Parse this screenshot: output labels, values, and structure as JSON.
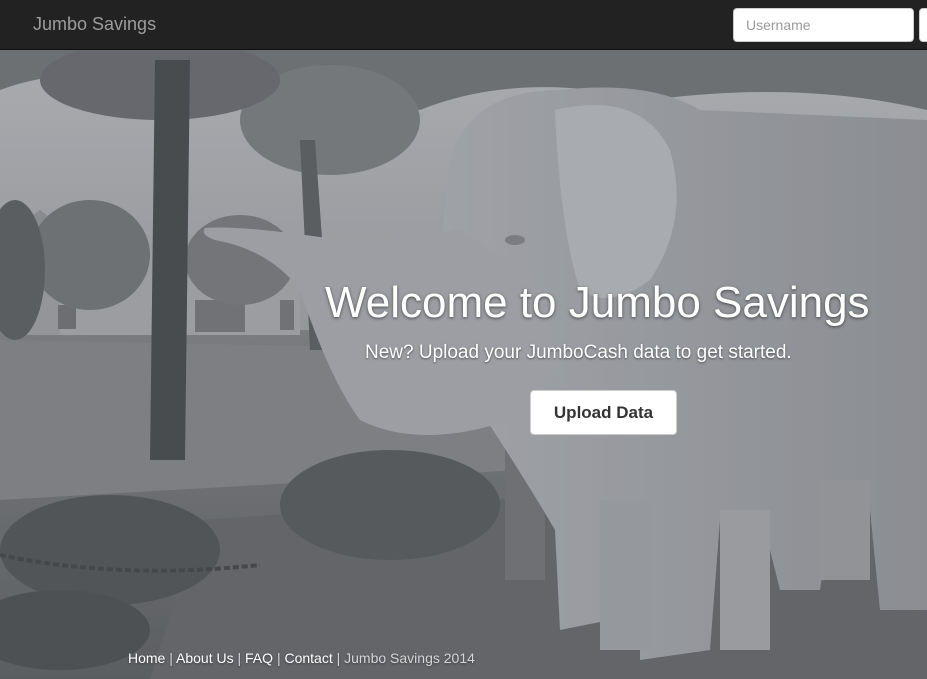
{
  "navbar": {
    "brand": "Jumbo Savings",
    "username_placeholder": "Username"
  },
  "hero": {
    "title": "Welcome to Jumbo Savings",
    "subtitle": "New? Upload your JumboCash data to get started.",
    "upload_button": "Upload Data"
  },
  "footer": {
    "links": [
      "Home",
      "About Us",
      "FAQ",
      "Contact"
    ],
    "separator": "|",
    "copyright": "Jumbo Savings 2014"
  },
  "colors": {
    "navbar_bg": "#222222",
    "brand_text": "#9d9d9d",
    "hero_text": "#ffffff"
  }
}
